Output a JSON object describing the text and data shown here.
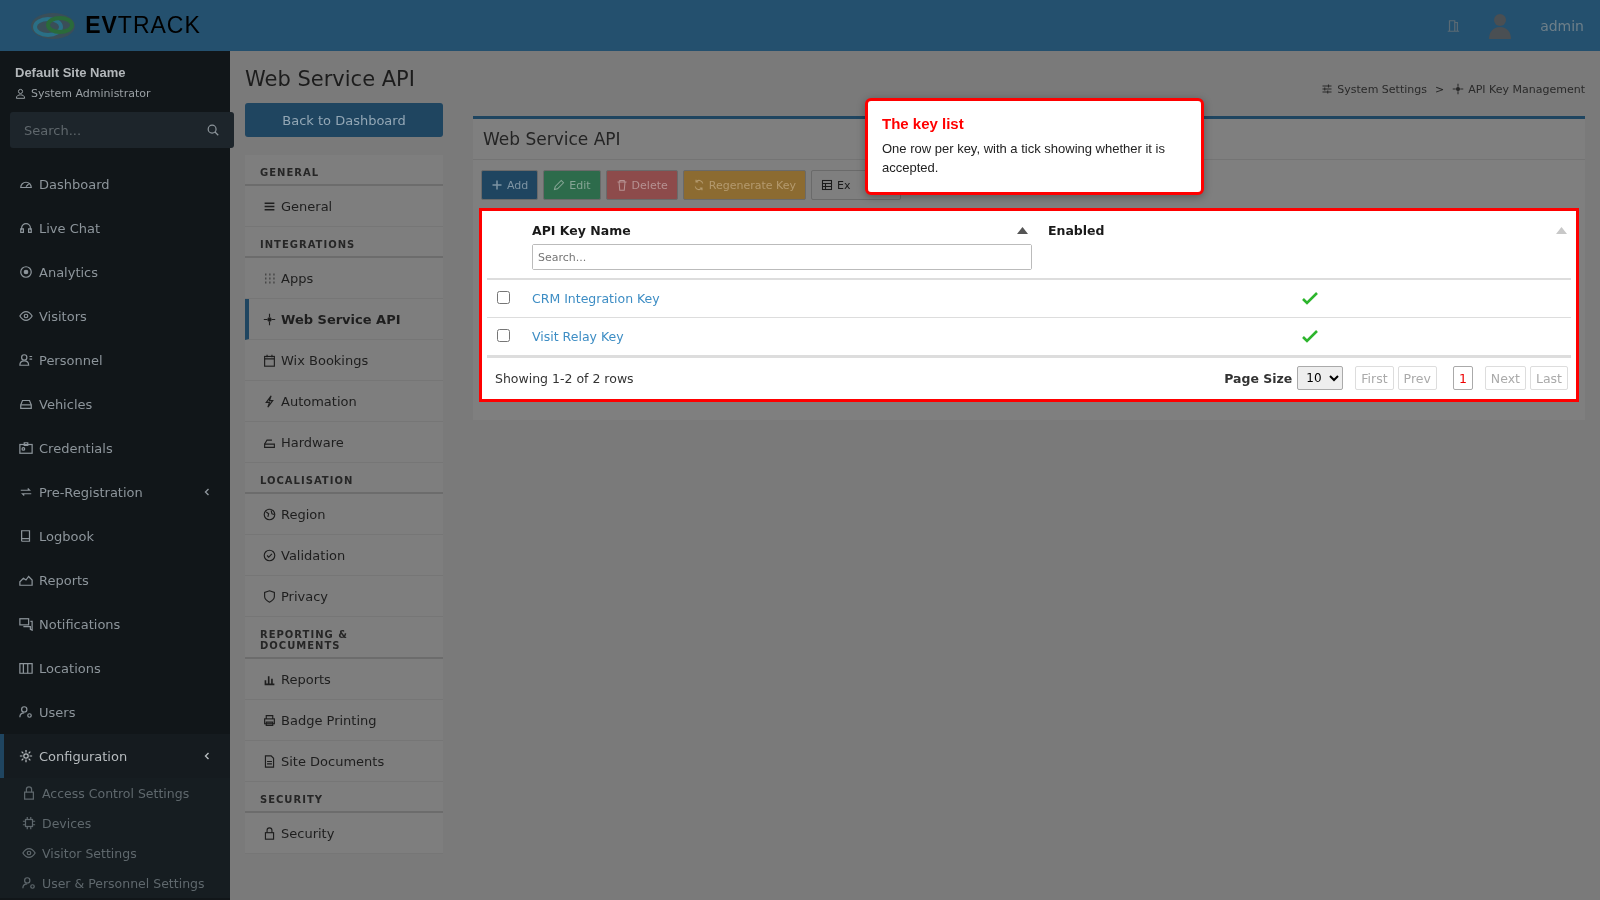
{
  "topbar": {
    "logo": "**EV**TRACK",
    "user": "admin"
  },
  "site": {
    "name": "Default Site Name",
    "role": "System Administrator"
  },
  "sidebar": {
    "search_placeholder": "Search...",
    "items": [
      {
        "label": "Dashboard",
        "selected": false,
        "submenu": false
      },
      {
        "label": "Live Chat",
        "selected": false,
        "submenu": false
      },
      {
        "label": "Analytics",
        "selected": false,
        "submenu": false
      },
      {
        "label": "Visitors",
        "selected": false,
        "submenu": false
      },
      {
        "label": "Personnel",
        "selected": false,
        "submenu": false
      },
      {
        "label": "Vehicles",
        "selected": false,
        "submenu": false
      },
      {
        "label": "Credentials",
        "selected": false,
        "submenu": false
      },
      {
        "label": "Pre-Registration",
        "selected": false,
        "submenu": true
      },
      {
        "label": "Logbook",
        "selected": false,
        "submenu": false
      },
      {
        "label": "Reports",
        "selected": false,
        "submenu": false
      },
      {
        "label": "Notifications",
        "selected": false,
        "submenu": false
      },
      {
        "label": "Locations",
        "selected": false,
        "submenu": false
      },
      {
        "label": "Users",
        "selected": false,
        "submenu": false
      },
      {
        "label": "Configuration",
        "selected": true,
        "submenu": true,
        "children": [
          {
            "label": "Access Control Settings"
          },
          {
            "label": "Devices"
          },
          {
            "label": "Visitor Settings"
          },
          {
            "label": "User & Personnel Settings"
          }
        ]
      }
    ]
  },
  "page": {
    "title": "Web Service API",
    "back_button": "Back to Dashboard",
    "breadcrumb": [
      "System Settings",
      "API Key Management"
    ],
    "breadcrumb_separator": ">"
  },
  "settings_menu": [
    {
      "heading": "GENERAL",
      "items": [
        {
          "label": "General",
          "selected": false
        }
      ]
    },
    {
      "heading": "INTEGRATIONS",
      "items": [
        {
          "label": "Apps",
          "selected": false
        },
        {
          "label": "Web Service API",
          "selected": true
        },
        {
          "label": "Wix Bookings",
          "selected": false
        },
        {
          "label": "Automation",
          "selected": false
        },
        {
          "label": "Hardware",
          "selected": false
        }
      ]
    },
    {
      "heading": "LOCALISATION",
      "items": [
        {
          "label": "Region",
          "selected": false
        },
        {
          "label": "Validation",
          "selected": false
        },
        {
          "label": "Privacy",
          "selected": false
        }
      ]
    },
    {
      "heading": "REPORTING & DOCUMENTS",
      "items": [
        {
          "label": "Reports",
          "selected": false
        },
        {
          "label": "Badge Printing",
          "selected": false
        },
        {
          "label": "Site Documents",
          "selected": false
        }
      ]
    },
    {
      "heading": "SECURITY",
      "items": [
        {
          "label": "Security",
          "selected": false
        }
      ]
    }
  ],
  "card": {
    "title": "Web Service API",
    "toolbar": [
      {
        "label": "Add",
        "kind": "primary"
      },
      {
        "label": "Edit",
        "kind": "success"
      },
      {
        "label": "Delete",
        "kind": "danger"
      },
      {
        "label": "Regenerate Key",
        "kind": "warning"
      },
      {
        "label": "Ex",
        "kind": "default"
      }
    ],
    "table": {
      "columns": [
        {
          "label": "API Key Name",
          "sorted": true
        },
        {
          "label": "Enabled",
          "sorted": false
        }
      ],
      "filter_placeholder": "Search...",
      "rows": [
        {
          "checked": false,
          "name": "CRM Integration Key",
          "enabled": true
        },
        {
          "checked": false,
          "name": "Visit Relay Key",
          "enabled": true
        }
      ],
      "summary": "Showing 1-2 of 2 rows",
      "page_size_label": "Page Size",
      "page_size": "10",
      "pager": [
        {
          "label": "First",
          "selected": false
        },
        {
          "label": "Prev",
          "selected": false
        },
        {
          "label": "1",
          "selected": true
        },
        {
          "label": "Next",
          "selected": false
        },
        {
          "label": "Last",
          "selected": false
        }
      ]
    }
  },
  "tooltip": {
    "title": "The key list",
    "text": "One row per key, with a tick showing whether it is accepted."
  }
}
